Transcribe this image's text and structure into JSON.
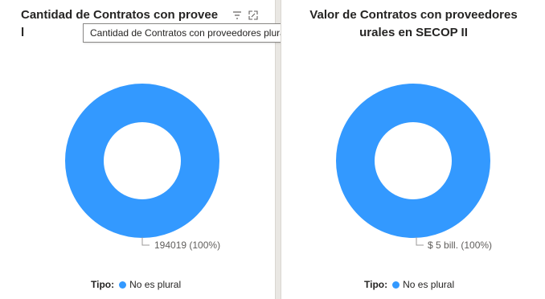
{
  "colors": {
    "series": "#3399ff"
  },
  "left_card": {
    "title": "Cantidad de Contratos con provee",
    "title_line2": "l",
    "tooltip": "Cantidad de Contratos con proveedores plurales en SECOP II",
    "icons": [
      "filter-icon",
      "expand-icon"
    ],
    "legend": {
      "title": "Tipo:",
      "entry": "No es plural"
    },
    "chart_data": {
      "type": "pie",
      "categories": [
        "No es plural"
      ],
      "values": [
        194019
      ],
      "data_labels": [
        "194019 (100%)"
      ],
      "legend": "bottom"
    }
  },
  "right_card": {
    "title_line1": "Valor de Contratos con proveedores",
    "title_line2": "urales en SECOP II",
    "legend": {
      "title": "Tipo:",
      "entry": "No es plural"
    },
    "chart_data": {
      "type": "pie",
      "categories": [
        "No es plural"
      ],
      "values": [
        5000000000000
      ],
      "data_labels": [
        "$ 5 bill. (100%)"
      ],
      "legend": "bottom"
    }
  }
}
